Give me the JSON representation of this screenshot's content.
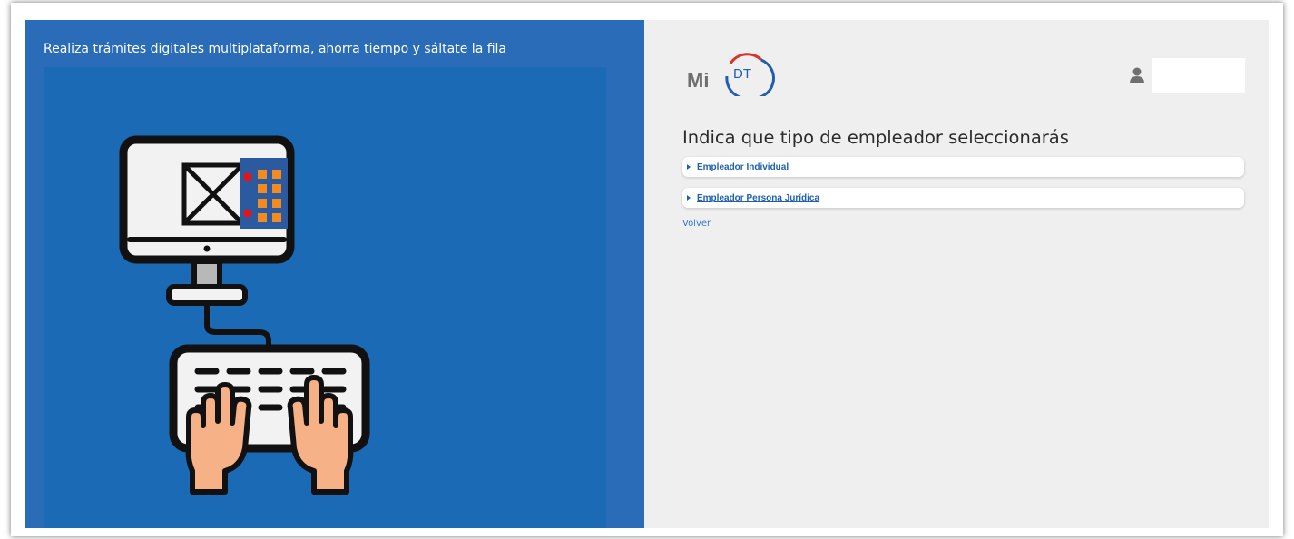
{
  "promo": {
    "tagline": "Realiza trámites digitales multiplataforma, ahorra tiempo y sáltate la fila",
    "illustration_icon": "computer-with-typing-hands-illustration"
  },
  "header": {
    "logo_text_prefix": "Mi",
    "logo_text_badge": "DT",
    "user_icon": "user-icon"
  },
  "main": {
    "title": "Indica que tipo de empleador seleccionarás",
    "options": [
      {
        "label": "Empleador Individual"
      },
      {
        "label": "Empleador Persona Jurídica"
      }
    ],
    "back_label": "Volver"
  },
  "colors": {
    "left_panel": "#2a6cb7",
    "illustration_bg": "#1a6ab5",
    "right_panel": "#efefef",
    "link": "#1e5fb0",
    "logo_red": "#d9342b",
    "logo_blue": "#1f5db3"
  }
}
